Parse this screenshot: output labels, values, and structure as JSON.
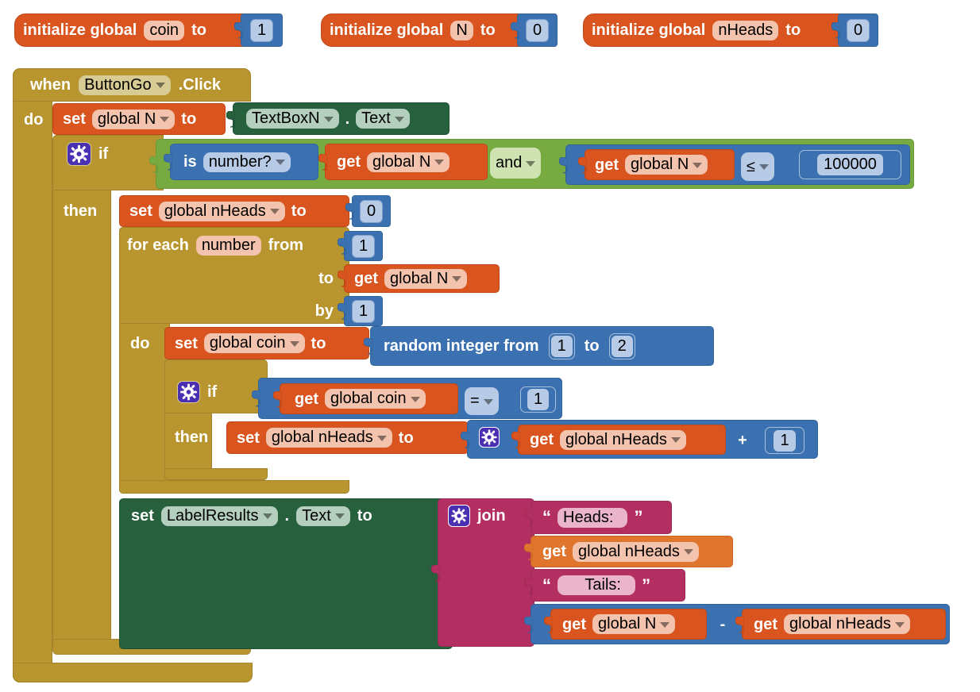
{
  "app": {
    "title": "MIT App Inventor Blocks Editor – coin flip simulation",
    "canvas_background": "#ffffff"
  },
  "colors": {
    "event_control": "#b8952e",
    "variable": "#d9541e",
    "logic": "#77ab41",
    "math": "#3b71b0",
    "text": "#b32f62",
    "component": "#26603d",
    "mutator_icon": "#4b2fb3"
  },
  "globals": [
    {
      "id": "global-coin",
      "keyword": "initialize global",
      "name": "coin",
      "to_label": "to",
      "value": "1",
      "value_type": "math"
    },
    {
      "id": "global-n",
      "keyword": "initialize global",
      "name": "N",
      "to_label": "to",
      "value": "0",
      "value_type": "math"
    },
    {
      "id": "global-nheads",
      "keyword": "initialize global",
      "name": "nHeads",
      "to_label": "to",
      "value": "0",
      "value_type": "math"
    }
  ],
  "event": {
    "when_label": "when",
    "component": "ButtonGo",
    "event_suffix": ".Click",
    "do_label": "do"
  },
  "set_n": {
    "set_label": "set",
    "variable": "global N",
    "to_label": "to",
    "component": "TextBoxN",
    "dot": ".",
    "property": "Text"
  },
  "outer_if": {
    "mutator_icon": "gear-icon",
    "if_label": "if",
    "then_label": "then",
    "condition": {
      "left": {
        "is_label": "is",
        "test": "number?",
        "get_label": "get",
        "variable": "global N"
      },
      "operator": "and",
      "right": {
        "get_label": "get",
        "variable": "global N",
        "comparison": "≤",
        "value": "100000"
      }
    }
  },
  "set_nheads_zero": {
    "set_label": "set",
    "variable": "global nHeads",
    "to_label": "to",
    "value": "0"
  },
  "for_each": {
    "for_each_label": "for each",
    "loop_var": "number",
    "from_label": "from",
    "from_value": "1",
    "to_label": "to",
    "to_get_label": "get",
    "to_variable": "global N",
    "by_label": "by",
    "by_value": "1",
    "do_label": "do"
  },
  "set_coin": {
    "set_label": "set",
    "variable": "global coin",
    "to_label": "to",
    "random_label": "random integer from",
    "from_value": "1",
    "to_label2": "to",
    "to_value": "2"
  },
  "inner_if": {
    "mutator_icon": "gear-icon",
    "if_label": "if",
    "then_label": "then",
    "condition": {
      "get_label": "get",
      "variable": "global coin",
      "comparison": "=",
      "value": "1"
    }
  },
  "increment_nheads": {
    "set_label": "set",
    "variable": "global nHeads",
    "to_label": "to",
    "mutator_icon": "gear-icon",
    "get_label": "get",
    "get_variable": "global nHeads",
    "operator": "+",
    "operand": "1"
  },
  "set_label_results": {
    "set_label": "set",
    "component": "LabelResults",
    "dot": ".",
    "property": "Text",
    "to_label": "to"
  },
  "join": {
    "mutator_icon": "gear-icon",
    "label": "join",
    "items": [
      {
        "kind": "text",
        "value": "Heads:  "
      },
      {
        "kind": "get",
        "get_label": "get",
        "variable": "global nHeads"
      },
      {
        "kind": "text",
        "value": "     Tails:  "
      },
      {
        "kind": "math",
        "left_get_label": "get",
        "left_variable": "global N",
        "operator": "-",
        "right_get_label": "get",
        "right_variable": "global nHeads"
      }
    ]
  }
}
